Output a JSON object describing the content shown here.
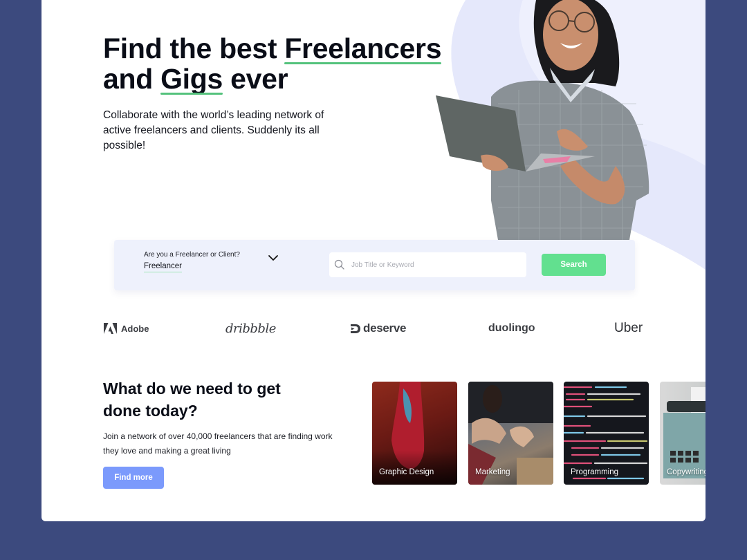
{
  "hero": {
    "title_part1": "Find the best ",
    "title_highlight1": "Freelancers",
    "title_part2": "and ",
    "title_highlight2": "Gigs",
    "title_part3": " ever",
    "subtitle": "Collaborate with the world’s leading network of active freelancers and clients. Suddenly its all possible!"
  },
  "search": {
    "role_label": "Are you a Freelancer or Client?",
    "role_value": "Freelancer",
    "input_value": "",
    "input_placeholder": "Job Title or Keyword",
    "button_label": "Search"
  },
  "logos": [
    {
      "name": "Adobe",
      "icon": "adobe-logo-icon"
    },
    {
      "name": "dribbble",
      "icon": "dribbble-wordmark"
    },
    {
      "name": "deserve",
      "icon": "deserve-logo-icon"
    },
    {
      "name": "duolingo",
      "icon": "duolingo-wordmark"
    },
    {
      "name": "Uber",
      "icon": "uber-wordmark"
    }
  ],
  "categories_section": {
    "title": "What do we need to get done today?",
    "subtitle": "Join a network of over 40,000 freelancers that are finding work they love and making a great living",
    "button_label": "Find more",
    "cards": [
      {
        "label": "Graphic Design"
      },
      {
        "label": "Marketing"
      },
      {
        "label": "Programming"
      },
      {
        "label": "Copywriting"
      }
    ]
  },
  "colors": {
    "frame_background": "#3c4a7e",
    "accent_green": "#62e08f",
    "underline_green": "#54c27c",
    "accent_blue": "#7b9afc",
    "panel_lavender": "#eef1fc"
  }
}
